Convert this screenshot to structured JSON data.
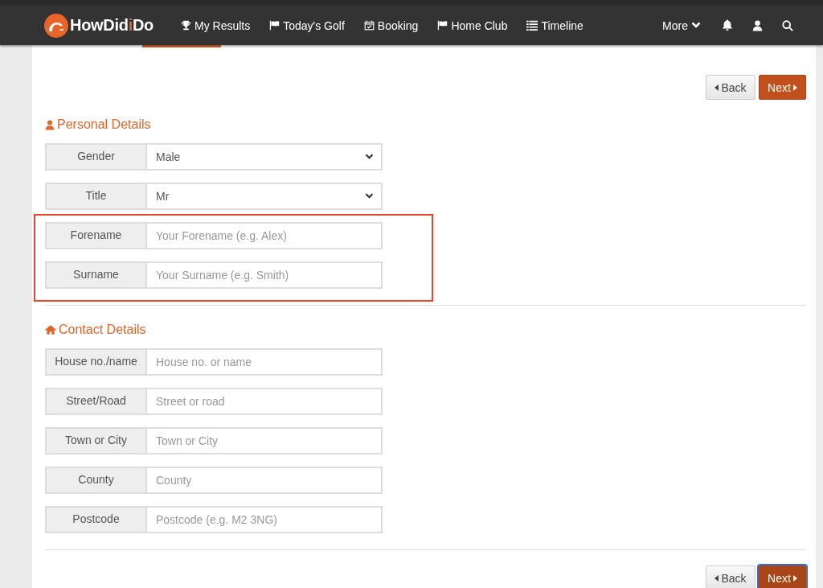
{
  "header": {
    "logo": [
      {
        "text": "HowDid",
        "accent": false
      },
      {
        "text": "i",
        "accent": true
      },
      {
        "text": "Do",
        "accent": false
      }
    ],
    "nav": [
      {
        "label": "My Results",
        "kind": "trophy"
      },
      {
        "label": "Today's Golf",
        "kind": "flag"
      },
      {
        "label": "Booking",
        "kind": "calendar"
      },
      {
        "label": "Home Club",
        "kind": "flag"
      },
      {
        "label": "Timeline",
        "kind": "list"
      }
    ],
    "more": {
      "label": "More"
    },
    "actions": [
      {
        "kind": "bell"
      },
      {
        "kind": "user"
      },
      {
        "kind": "search"
      }
    ]
  },
  "top_buttons": [
    {
      "label": "Back",
      "kind": "back",
      "focused": false
    },
    {
      "label": "Next",
      "kind": "next",
      "focused": false
    }
  ],
  "sections": [
    {
      "title": "Personal Details",
      "kind": "user",
      "rows": [
        {
          "label": "Gender",
          "kind": "select",
          "value": "Male",
          "highlighted": false
        },
        {
          "label": "Title",
          "kind": "select",
          "value": "Mr",
          "highlighted": false
        },
        {
          "label": "Forename",
          "kind": "input",
          "placeholder": "Your Forename (e.g. Alex)",
          "highlighted": true
        },
        {
          "label": "Surname",
          "kind": "input",
          "placeholder": "Your Surname (e.g. Smith)",
          "highlighted": true
        }
      ]
    },
    {
      "title": "Contact Details",
      "kind": "home",
      "rows": [
        {
          "label": "House no./name",
          "kind": "input",
          "placeholder": "House no. or name",
          "highlighted": false
        },
        {
          "label": "Street/Road",
          "kind": "input",
          "placeholder": "Street or road",
          "highlighted": false
        },
        {
          "label": "Town or City",
          "kind": "input",
          "placeholder": "Town or City",
          "highlighted": false
        },
        {
          "label": "County",
          "kind": "input",
          "placeholder": "County",
          "highlighted": false
        },
        {
          "label": "Postcode",
          "kind": "input",
          "placeholder": "Postcode (e.g. M2 3NG)",
          "highlighted": false
        }
      ]
    }
  ],
  "bottom_buttons": [
    {
      "label": "Back",
      "kind": "back",
      "focused": false
    },
    {
      "label": "Next",
      "kind": "next",
      "focused": true
    }
  ]
}
